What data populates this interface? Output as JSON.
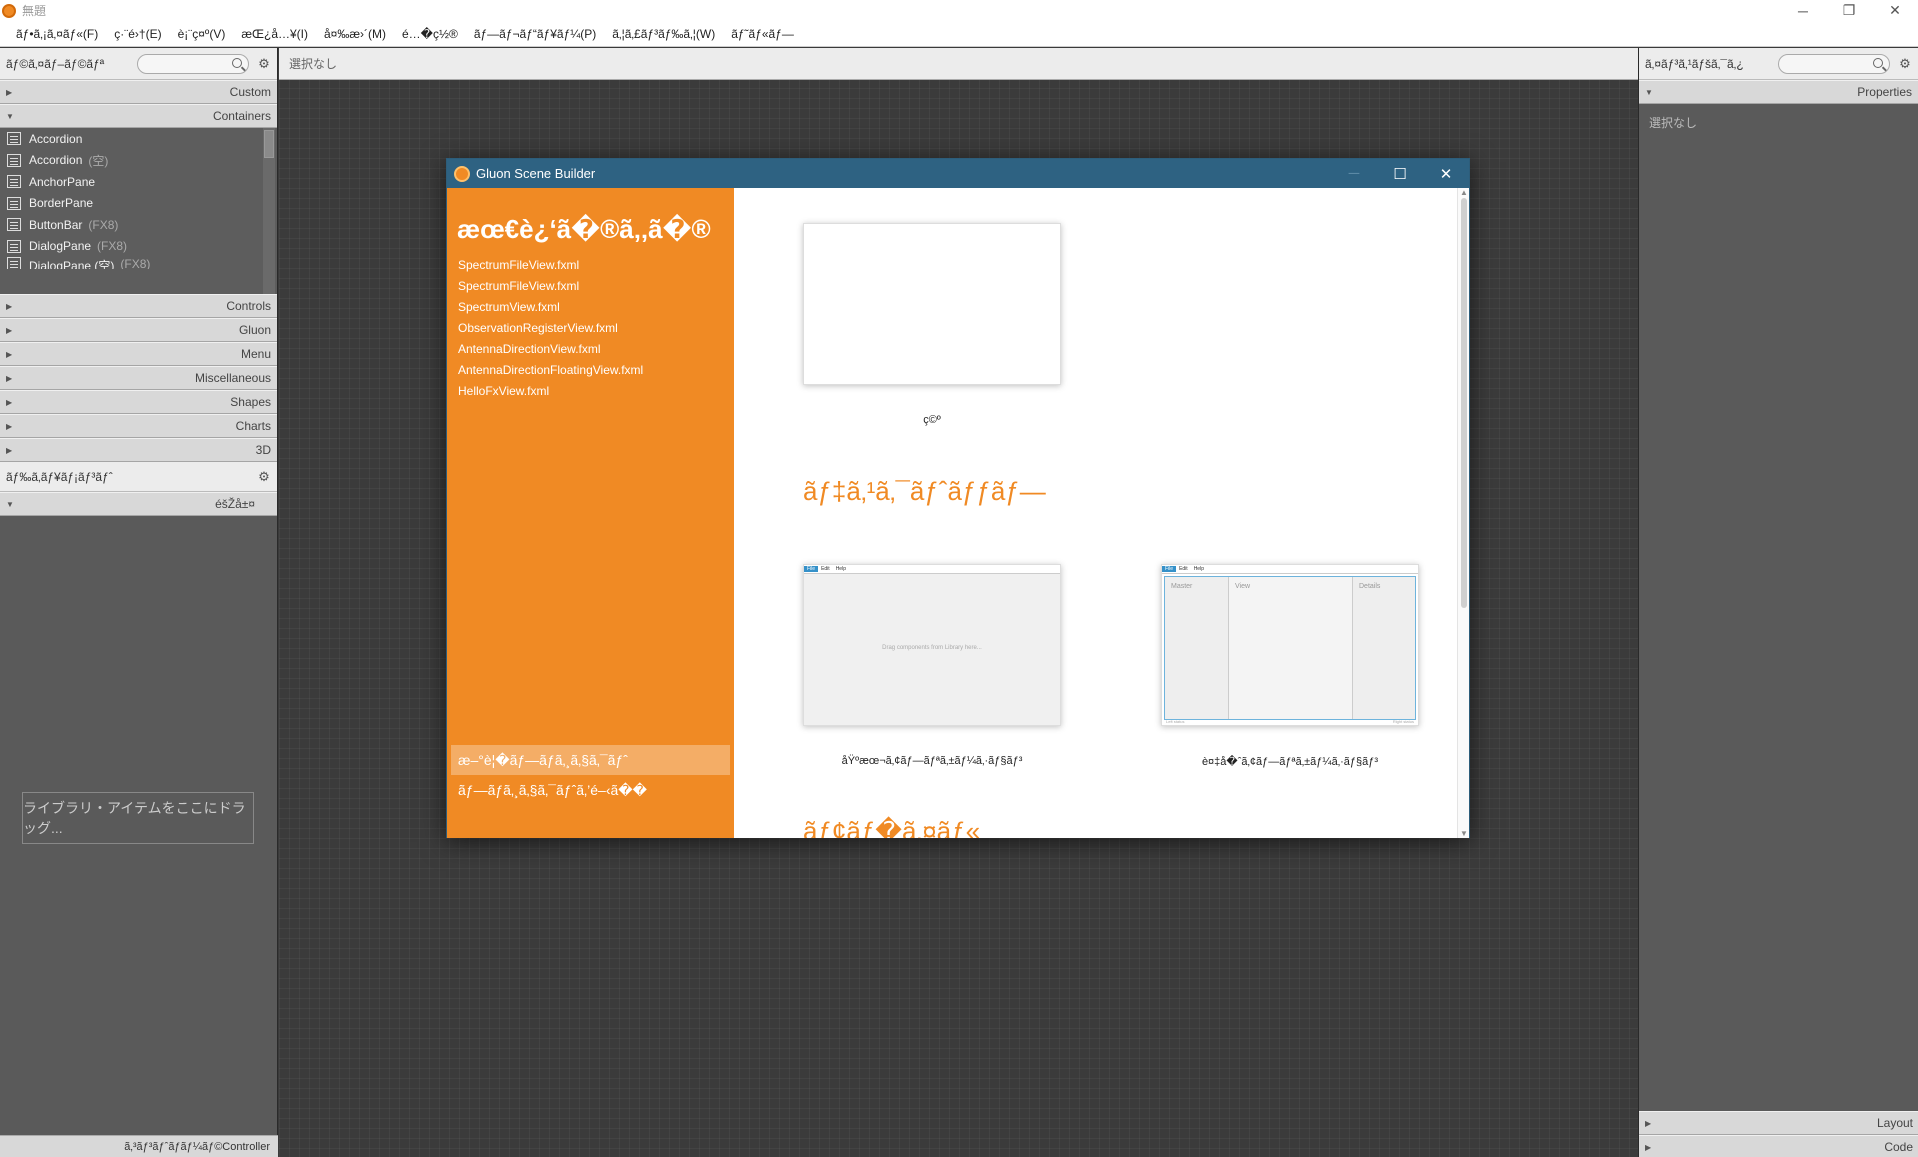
{
  "window": {
    "title": "無題",
    "controls": {
      "minimize": "─",
      "restore": "❐",
      "close": "✕"
    }
  },
  "menubar": {
    "items": [
      "ãƒ•ã‚¡ã‚¤ãƒ«(F)",
      "ç·¨é›†(E)",
      "è¡¨ç¤º(V)",
      "æŒ¿å…¥(I)",
      "å¤‰æ›´(M)",
      "é…�ç½®",
      "ãƒ—ãƒ¬ãƒ“ãƒ¥ãƒ¼(P)",
      "ã‚¦ã‚£ãƒ³ãƒ‰ã‚¦(W)",
      "ãƒ˜ãƒ«ãƒ—"
    ]
  },
  "left": {
    "library_title": "ãƒ©ã‚¤ãƒ–ãƒ©ãƒª",
    "sections_top": [
      "Custom",
      "Containers"
    ],
    "library_items": [
      {
        "label": "Accordion",
        "suffix": ""
      },
      {
        "label": "Accordion",
        "suffix": "(空)"
      },
      {
        "label": "AnchorPane",
        "suffix": ""
      },
      {
        "label": "BorderPane",
        "suffix": ""
      },
      {
        "label": "ButtonBar",
        "suffix": "(FX8)"
      },
      {
        "label": "DialogPane",
        "suffix": "(FX8)"
      },
      {
        "label": "DialogPane (空)",
        "suffix": "(FX8)"
      }
    ],
    "sections_bottom": [
      "Controls",
      "Gluon",
      "Menu",
      "Miscellaneous",
      "Shapes",
      "Charts",
      "3D"
    ],
    "document_title": "ãƒ‰ã‚­ãƒ¥ãƒ¡ãƒ³ãƒˆ",
    "hierarchy_label": "éšŽå±¤",
    "drop_hint": "ライブラリ・アイテムをここにドラッグ...",
    "controller_label": "ã‚³ãƒ³ãƒˆãƒ­ãƒ¼ãƒ©Controller"
  },
  "center": {
    "selection_label": "選択なし"
  },
  "right": {
    "inspector_title": "ã‚¤ãƒ³ã‚¹ãƒšã‚¯ã‚¿",
    "properties_label": "Properties",
    "no_selection": "選択なし",
    "layout_label": "Layout",
    "code_label": "Code"
  },
  "dialog": {
    "title": "Gluon Scene Builder",
    "recent_title": "æœ€è¿‘ã�®ã‚‚ã�®",
    "recent_files": [
      "SpectrumFileView.fxml",
      "SpectrumFileView.fxml",
      "SpectrumView.fxml",
      "ObservationRegisterView.fxml",
      "AntennaDirectionView.fxml",
      "AntennaDirectionFloatingView.fxml",
      "HelloFxView.fxml"
    ],
    "side_actions": [
      "æ–°è¦�ãƒ—ãƒ­ã‚¸ã‚§ã‚¯ãƒˆ",
      "ãƒ—ãƒ­ã‚¸ã‚§ã‚¯ãƒˆã‚’é–‹ã��"
    ],
    "empty_caption": "ç©º",
    "desktop_section": "ãƒ‡ã‚¹ã‚¯ãƒˆãƒƒãƒ—",
    "template_captions": [
      "åŸºæœ¬ã‚¢ãƒ—ãƒªã‚±ãƒ¼ã‚·ãƒ§ãƒ³",
      "è¤‡å�ˆã‚¢ãƒ—ãƒªã‚±ãƒ¼ã‚·ãƒ§ãƒ³"
    ],
    "mobile_section": "ãƒ¢ãƒ�ã‚¤ãƒ«",
    "mini_menu": [
      "File",
      "Edit",
      "Help"
    ],
    "mini_hint": "Drag components from Library here...",
    "mini_panes": [
      "Master",
      "View",
      "Details"
    ],
    "mini_status": [
      "Left status",
      "Right status"
    ]
  },
  "colors": {
    "accent_orange": "#f08a24",
    "dialog_title_blue": "#2e6282",
    "panel_gray": "#5a5a5a",
    "canvas_dark": "#3b3b3b"
  }
}
